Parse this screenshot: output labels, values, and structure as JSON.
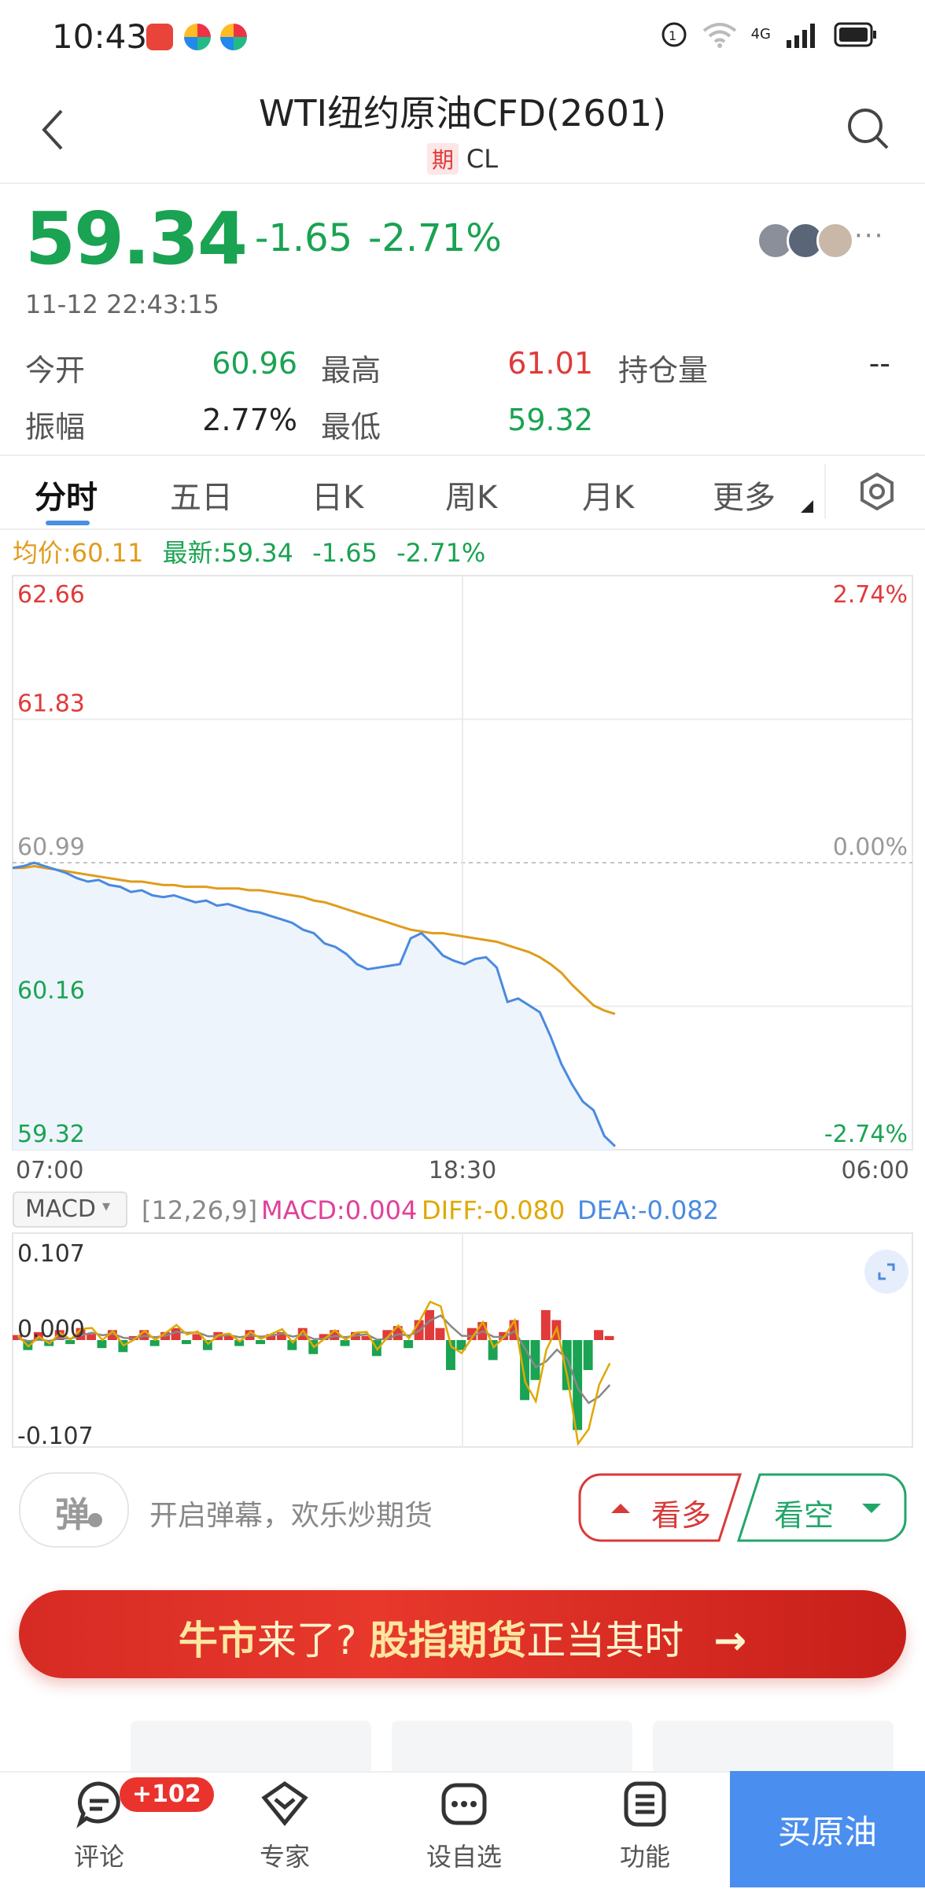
{
  "status_bar": {
    "time": "10:43",
    "network": "4G"
  },
  "header": {
    "title": "WTI纽约原油CFD(2601)",
    "tag": "期",
    "code": "CL"
  },
  "quote": {
    "price": "59.34",
    "change": "-1.65",
    "change_pct": "-2.71%",
    "timestamp": "11-12 22:43:15",
    "more": "···"
  },
  "stats": {
    "open_label": "今开",
    "open": "60.96",
    "high_label": "最高",
    "high": "61.01",
    "oi_label": "持仓量",
    "oi": "--",
    "amp_label": "振幅",
    "amp": "2.77%",
    "low_label": "最低",
    "low": "59.32"
  },
  "tabs": [
    "分时",
    "五日",
    "日K",
    "周K",
    "月K",
    "更多"
  ],
  "chart_info": {
    "avg": "均价:60.11",
    "latest": "最新:59.34",
    "chg": "-1.65",
    "pct": "-2.71%"
  },
  "chart_data": [
    {
      "type": "line",
      "y_left_ticks": [
        "62.66",
        "61.83",
        "60.99",
        "60.16",
        "59.32"
      ],
      "y_right_ticks": [
        "2.74%",
        "0.00%",
        "-2.74%"
      ],
      "x_ticks": [
        "07:00",
        "18:30",
        "06:00"
      ],
      "ylim": [
        59.32,
        62.66
      ],
      "reference": 60.99,
      "series": [
        {
          "name": "最新",
          "values": [
            60.96,
            60.97,
            60.99,
            60.97,
            60.95,
            60.93,
            60.9,
            60.88,
            60.89,
            60.86,
            60.85,
            60.82,
            60.83,
            60.8,
            60.79,
            60.8,
            60.78,
            60.76,
            60.77,
            60.74,
            60.75,
            60.73,
            60.71,
            60.7,
            60.68,
            60.66,
            60.64,
            60.6,
            60.58,
            60.52,
            60.5,
            60.46,
            60.4,
            60.37,
            60.38,
            60.39,
            60.4,
            60.55,
            60.58,
            60.52,
            60.45,
            60.42,
            60.4,
            60.43,
            60.44,
            60.38,
            60.18,
            60.2,
            60.16,
            60.12,
            59.98,
            59.82,
            59.7,
            59.6,
            59.55,
            59.4,
            59.34
          ]
        },
        {
          "name": "均价",
          "values": [
            60.96,
            60.96,
            60.97,
            60.96,
            60.95,
            60.94,
            60.93,
            60.92,
            60.91,
            60.9,
            60.89,
            60.88,
            60.88,
            60.87,
            60.86,
            60.86,
            60.85,
            60.85,
            60.85,
            60.84,
            60.84,
            60.84,
            60.83,
            60.83,
            60.82,
            60.81,
            60.8,
            60.79,
            60.77,
            60.76,
            60.74,
            60.72,
            60.7,
            60.68,
            60.66,
            60.64,
            60.62,
            60.6,
            60.59,
            60.58,
            60.58,
            60.57,
            60.56,
            60.55,
            60.54,
            60.53,
            60.51,
            60.49,
            60.47,
            60.44,
            60.4,
            60.35,
            60.28,
            60.22,
            60.16,
            60.13,
            60.11
          ]
        }
      ]
    },
    {
      "type": "bar",
      "indicator": "MACD",
      "params": "[12,26,9]",
      "macd_label": "MACD:0.004",
      "diff_label": "DIFF:-0.080",
      "dea_label": "DEA:-0.082",
      "y_ticks": [
        "0.107",
        "0.000",
        "-0.107"
      ],
      "ylim": [
        -0.107,
        0.107
      ],
      "values": [
        0.005,
        -0.01,
        0.008,
        -0.006,
        0.01,
        -0.004,
        0.012,
        0.006,
        -0.008,
        0.01,
        -0.012,
        0.004,
        0.01,
        -0.006,
        0.008,
        0.012,
        -0.004,
        0.006,
        -0.01,
        0.008,
        0.004,
        -0.006,
        0.01,
        -0.004,
        0.006,
        0.008,
        -0.01,
        0.012,
        -0.014,
        0.006,
        0.01,
        -0.006,
        0.008,
        0.004,
        -0.016,
        0.01,
        0.014,
        -0.008,
        0.02,
        0.03,
        0.012,
        -0.03,
        -0.01,
        0.012,
        0.018,
        -0.02,
        0.008,
        0.02,
        -0.06,
        -0.04,
        0.03,
        0.02,
        -0.05,
        -0.09,
        -0.03,
        0.01,
        0.004
      ]
    }
  ],
  "actions": {
    "danmu_icon": "弹",
    "danmu_text": "开启弹幕，欢乐炒期货",
    "bull": "看多",
    "bear": "看空"
  },
  "banner": {
    "p1": "牛市",
    "p2": "来了?",
    "p3": "股指期货",
    "p4": "正当其时",
    "arrow": "→"
  },
  "bottom_nav": {
    "comment": "评论",
    "comment_badge": "+102",
    "expert": "专家",
    "watchlist": "设自选",
    "function": "功能",
    "buy": "买原油"
  },
  "colors": {
    "up": "#e03a3a",
    "down": "#1aa352",
    "price_line": "#4a8adf",
    "avg_line": "#e09c1c",
    "macd_pink": "#e0409a",
    "diff": "#e0a800",
    "dea": "#4a8adf"
  }
}
